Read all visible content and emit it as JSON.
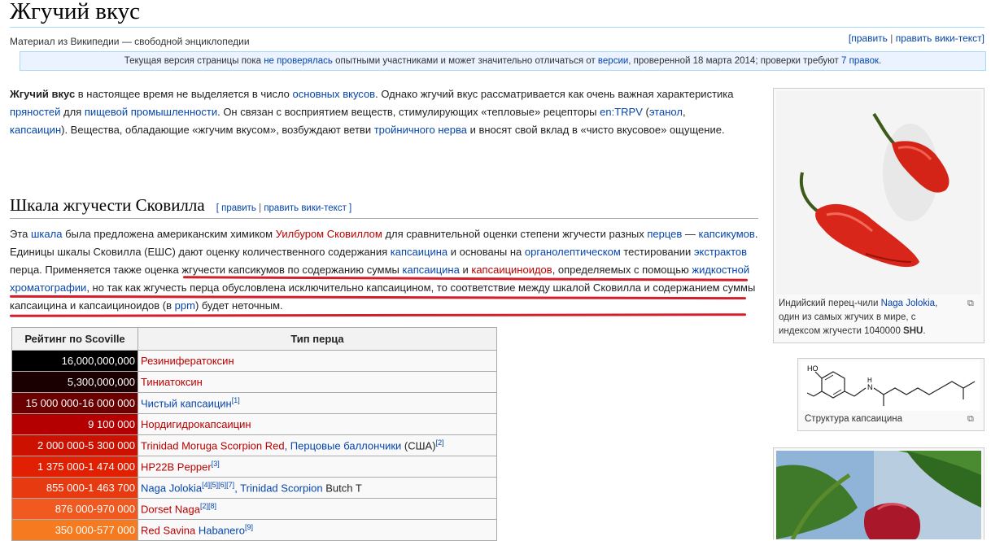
{
  "header": {
    "title": "Жгучий вкус",
    "from": "Материал из Википедии — свободной энциклопедии",
    "edit": "[править",
    "sep": " | ",
    "edit_wiki": "править вики-текст]"
  },
  "notice": {
    "t1": "Текущая версия страницы пока ",
    "l1": "не проверялась",
    "t2": " опытными участниками и может значительно отличаться от ",
    "l2": "версии",
    "t3": ", проверенной 18 марта 2014; проверки требуют ",
    "l3": "7 правок",
    "t4": "."
  },
  "intro": {
    "bold": "Жгучий вкус",
    "t1": " в настоящее время не выделяется в число ",
    "l1": "основных вкусов",
    "t2": ". Однако жгучий вкус рассматривается как очень важная характеристика ",
    "l2": "пряностей",
    "t3": " для ",
    "l3": "пищевой промышленности",
    "t4": ". Он связан с восприятием веществ, стимулирующих «тепловые» рецепторы ",
    "l4": "en:TRPV",
    "t5": " (",
    "l5": "этанол",
    "t6": ", ",
    "l6": "капсаицин",
    "t7": "). Вещества, обладающие «жгучим вкусом», возбуждают ветви ",
    "l7": "тройничного нерва",
    "t8": " и вносят свой вклад в «чисто вкусовое» ощущение."
  },
  "section": {
    "heading": "Шкала жгучести Сковилла",
    "edit": "[ править",
    "sep": " | ",
    "edit_wiki": "править вики-текст ]"
  },
  "scale": {
    "t1": "Эта ",
    "l1": "шкала",
    "t2": " была предложена американским химиком ",
    "l2": "Уилбуром Сковиллом",
    "t3": " для сравнительной оценки степени жгучести разных ",
    "l3": "перцев",
    "t4": " — ",
    "l4": "капсикумов",
    "t5": ". Единицы шкалы Сковилла (ЕШС) дают оценку количественного содержания ",
    "l5": "капсаицина",
    "t6": " и основаны на ",
    "l6": "органолептическом",
    "t7": " тестировании ",
    "l7": "экстрактов",
    "t8": " перца. Применяется также оценка жгучести капсикумов по содержанию суммы ",
    "l8": "капсаицина",
    "t9": " и ",
    "l9": "капсаициноидов",
    "t10": ", определяемых с помощью ",
    "l10": "жидкостной хроматографии",
    "t11": ", но так как жгучесть перца обусловлена исключительно капсаицином, то соответствие между шкалой Сковилла и содержанием суммы капсаицина и капсаициноидов (в ",
    "l11": "ppm",
    "t12": ") будет неточным."
  },
  "table": {
    "headers": [
      "Рейтинг по Scoville",
      "Тип перца"
    ],
    "rows": [
      {
        "value": "16,000,000,000",
        "bg": "#000000",
        "name": "Резинифератоксин",
        "name_color": "red",
        "refs": "",
        "extra": ""
      },
      {
        "value": "5,300,000,000",
        "bg": "#1a0000",
        "name": "Тиниатоксин",
        "name_color": "red",
        "refs": "",
        "extra": ""
      },
      {
        "value": "15 000 000-16 000 000",
        "bg": "#6b0000",
        "name": "Чистый капсаицин",
        "name_color": "blue",
        "refs": "[1]",
        "extra": ""
      },
      {
        "value": "9 100 000",
        "bg": "#b40000",
        "name": "Нордигидрокапсаицин",
        "name_color": "red",
        "refs": "",
        "extra": ""
      },
      {
        "value": "2 000 000-5 300 000",
        "bg": "#cc1100",
        "name": "Trinidad Moruga Scorpion Red",
        "name_color": "red",
        "refs": "",
        "extra": ", Перцовые баллончики",
        "extra2": " (США)",
        "refs2": "[2]"
      },
      {
        "value": "1 375 000-1 474 000",
        "bg": "#e02000",
        "name": "HP22B Pepper",
        "name_color": "red",
        "refs": "[3]",
        "extra": ""
      },
      {
        "value": "855 000-1 463 700",
        "bg": "#e83a10",
        "name": "Naga Jolokia",
        "name_color": "blue",
        "refs": "[4][5][6][7]",
        "extra": ", Trinidad Scorpion",
        "extra2": " Butch T"
      },
      {
        "value": "876 000-970 000",
        "bg": "#f05a20",
        "name": "Dorset Naga",
        "name_color": "red",
        "refs": "[2][8]",
        "extra": ""
      },
      {
        "value": "350 000-577 000",
        "bg": "#f57a20",
        "name": "Red Savina",
        "name_color": "red",
        "refs": "",
        "extra": " Habanero",
        "refs2": "[9]"
      }
    ]
  },
  "figure1": {
    "cap1": "Индийский перец-чили ",
    "link": "Naga Jolokia",
    "cap2": ", один из самых жгучих в мире, с индексом жгучести 1040000 ",
    "bold": "SHU",
    "cap3": "."
  },
  "figure2": {
    "caption": "Структура капсаицина",
    "ho_label": "HO",
    "nh_label": "N",
    "h_label": "H"
  },
  "colors": {
    "link": "#0645ad",
    "redlink": "#ba0000",
    "annotation_red": "#d21f2b",
    "notice_bg": "#eaf3ff"
  }
}
